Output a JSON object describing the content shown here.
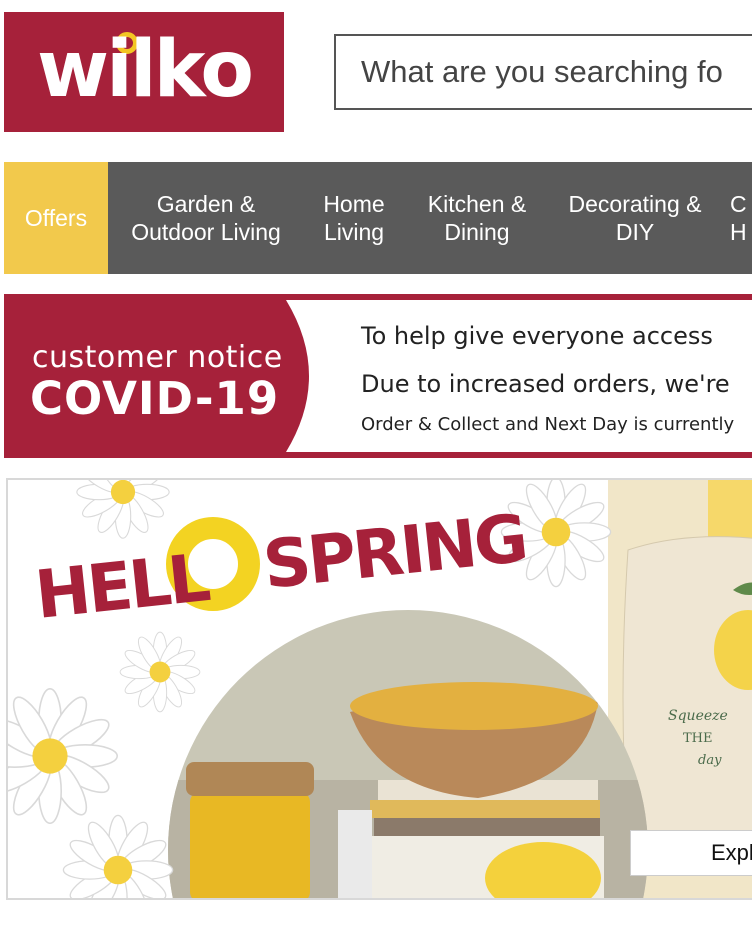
{
  "header": {
    "logo_text": "wilko",
    "search_placeholder": "What are you searching fo"
  },
  "nav": {
    "items": [
      {
        "label": "Offers"
      },
      {
        "label": "Garden &\nOutdoor Living"
      },
      {
        "label": "Home\nLiving"
      },
      {
        "label": "Kitchen &\nDining"
      },
      {
        "label": "Decorating &\nDIY"
      },
      {
        "label": "C\nH"
      }
    ]
  },
  "notice": {
    "badge_small": "customer notice",
    "badge_big": "COVID-19",
    "line1": "To help give everyone access",
    "line2": "Due to increased orders, we're",
    "line3": "Order & Collect and Next Day is currently"
  },
  "hero": {
    "headline_left": "HELL",
    "headline_right": "SPRING",
    "pillow_text": "Squeeze THE day",
    "cta_label": "Explo"
  },
  "colors": {
    "brand_red": "#a6213a",
    "offers_yellow": "#f2c94c",
    "nav_grey": "#5a5a5a",
    "accent_yellow": "#f3c623"
  }
}
